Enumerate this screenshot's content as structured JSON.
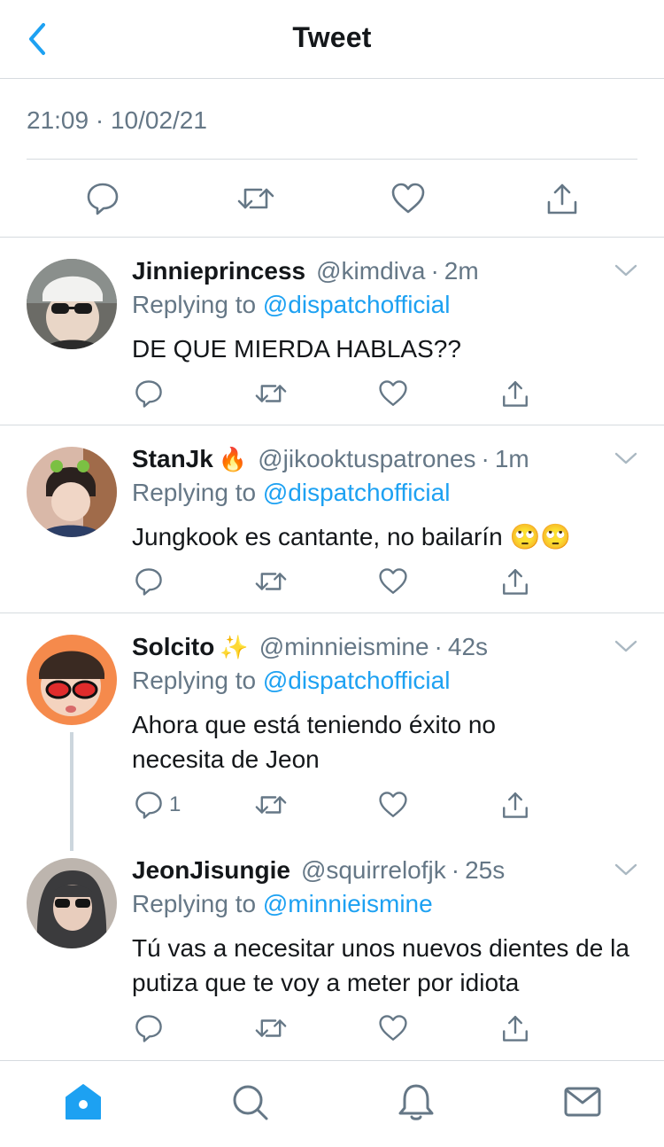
{
  "header": {
    "title": "Tweet",
    "back_icon": "chevron-left-icon"
  },
  "main_tweet": {
    "timestamp": "21:09 · 10/02/21",
    "actions": [
      "reply-icon",
      "retweet-icon",
      "like-icon",
      "share-icon"
    ]
  },
  "replies": [
    {
      "name": "Jinnieprincess",
      "emoji": "",
      "handle": "@kimdiva",
      "time": "2m",
      "replying_prefix": "Replying to",
      "replying_to": "@dispatchofficial",
      "text": "DE QUE MIERDA HABLAS??",
      "reply_count": ""
    },
    {
      "name": "StanJk",
      "emoji": "🔥",
      "handle": "@jikooktuspatrones",
      "time": "1m",
      "replying_prefix": "Replying to",
      "replying_to": "@dispatchofficial",
      "text": "Jungkook es cantante, no bailarín 🙄🙄",
      "reply_count": ""
    },
    {
      "name": "Solcito",
      "emoji": "✨",
      "handle": "@minnieismine",
      "time": "42s",
      "replying_prefix": "Replying to",
      "replying_to": "@dispatchofficial",
      "text": "Ahora que está teniendo éxito no necesita de Jeon",
      "reply_count": "1"
    },
    {
      "name": "JeonJisungie",
      "emoji": "",
      "handle": "@squirrelofjk",
      "time": "25s",
      "replying_prefix": "Replying to",
      "replying_to": "@minnieismine",
      "text": "Tú vas a necesitar unos nuevos dientes de la putiza que te voy a meter por idiota",
      "reply_count": ""
    }
  ],
  "tabbar": {
    "tabs": [
      "home-icon",
      "search-icon",
      "notifications-icon",
      "messages-icon"
    ],
    "active": "home-icon"
  },
  "colors": {
    "accent": "#1da1f2",
    "secondary_text": "#657786",
    "icon_gray": "#657786",
    "divider": "#d6dbdf"
  }
}
